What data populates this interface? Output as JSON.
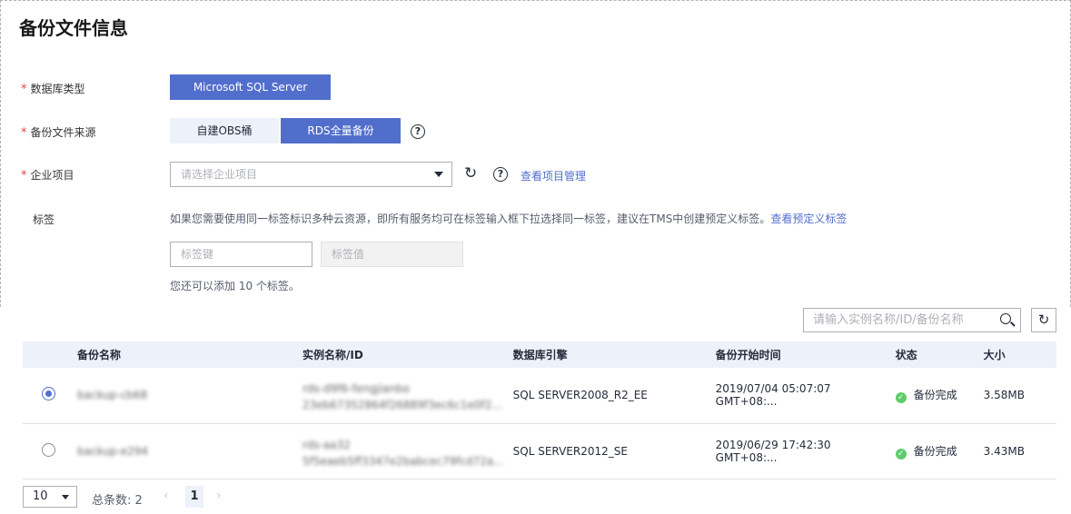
{
  "page_title": "备份文件信息",
  "form": {
    "db_type": {
      "label": "数据库类型",
      "value": "Microsoft SQL Server"
    },
    "source": {
      "label": "备份文件来源",
      "options": [
        "自建OBS桶",
        "RDS全量备份"
      ],
      "selected": "RDS全量备份"
    },
    "enterprise": {
      "label": "企业项目",
      "placeholder": "请选择企业项目",
      "link": "查看项目管理"
    },
    "tags": {
      "label": "标签",
      "hint": "如果您需要使用同一标签标识多种云资源，即所有服务均可在标签输入框下拉选择同一标签，建议在TMS中创建预定义标签。",
      "hint_link": "查看预定义标签",
      "key_placeholder": "标签键",
      "value_placeholder": "标签值",
      "count_text": "您还可以添加 10 个标签。"
    }
  },
  "search": {
    "placeholder": "请输入实例名称/ID/备份名称"
  },
  "table": {
    "headers": [
      "备份名称",
      "实例名称/ID",
      "数据库引擎",
      "备份开始时间",
      "状态",
      "大小"
    ],
    "rows": [
      {
        "selected": true,
        "name": "backup-cb68",
        "instance": "rds-d9f6-fengjianbo",
        "instance_id": "23eb67352864f26889f3ec6c1e0f2...",
        "engine": "SQL SERVER2008_R2_EE",
        "start": "2019/07/04 05:07:07 GMT+08:...",
        "status": "备份完成",
        "size": "3.58MB"
      },
      {
        "selected": false,
        "name": "backup-e294",
        "instance": "rds-aa32",
        "instance_id": "5f5eaeb5ff3347e2babcec79fcd72a...",
        "engine": "SQL SERVER2012_SE",
        "start": "2019/06/29 17:42:30 GMT+08:...",
        "status": "备份完成",
        "size": "3.43MB"
      }
    ]
  },
  "pager": {
    "page_size": "10",
    "total": "总条数: 2",
    "current": "1"
  },
  "colors": {
    "primary": "#526ecc",
    "success": "#5ecc6b",
    "required": "#e54545"
  },
  "icons": {
    "help": "help-icon",
    "refresh": "refresh-icon",
    "search": "search-icon"
  }
}
